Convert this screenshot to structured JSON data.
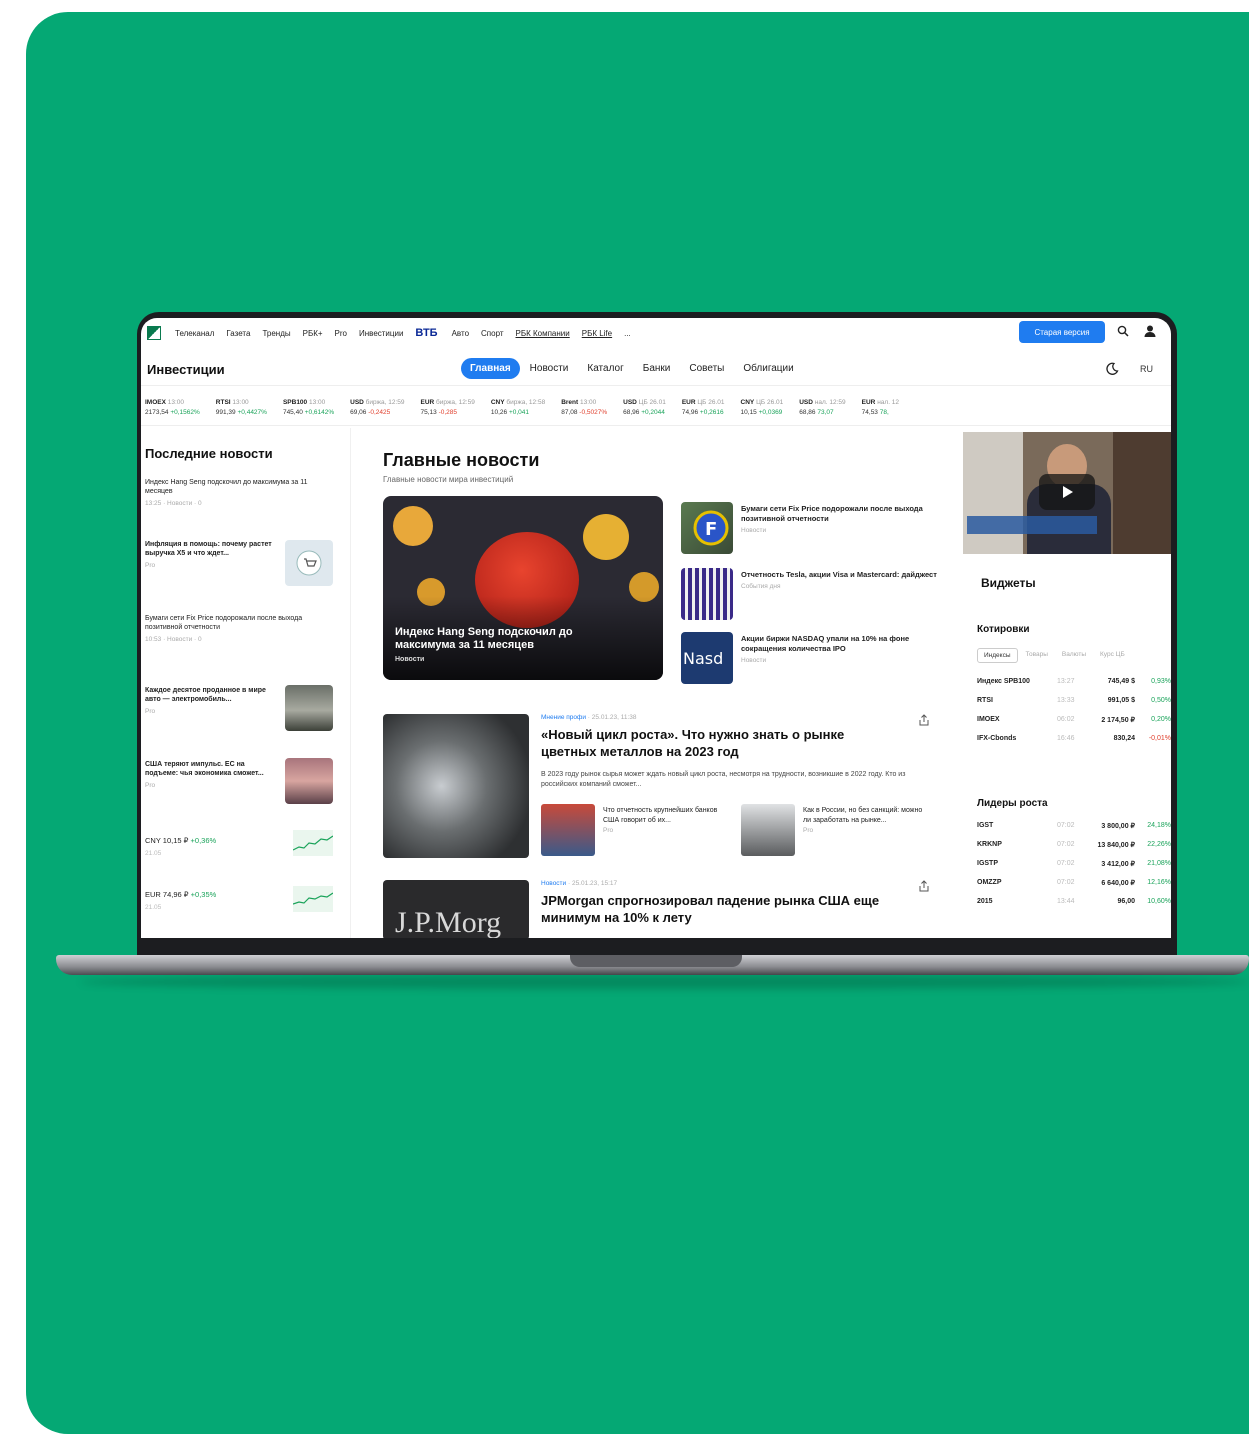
{
  "topnav": {
    "links": [
      "Телеканал",
      "Газета",
      "Тренды",
      "РБК+",
      "Pro",
      "Инвестиции"
    ],
    "partner": "ВТБ",
    "links2": [
      "Авто",
      "Спорт",
      "РБК Компании",
      "РБК Life",
      "..."
    ],
    "old_version": "Старая версия"
  },
  "section": {
    "title": "Инвестиции",
    "tabs": [
      "Главная",
      "Новости",
      "Каталог",
      "Банки",
      "Советы",
      "Облигации"
    ],
    "lang": "RU"
  },
  "ticker": [
    {
      "name": "IMOEX",
      "time": "13:00",
      "value": "2173,54",
      "change": "+0,1562%",
      "dir": "up"
    },
    {
      "name": "RTSI",
      "time": "13:00",
      "value": "991,39",
      "change": "+0,4427%",
      "dir": "up"
    },
    {
      "name": "SPB100",
      "time": "13:00",
      "value": "745,40",
      "change": "+0,6142%",
      "dir": "up"
    },
    {
      "name": "USD",
      "time": "биржа, 12:59",
      "value": "69,06",
      "change": "-0,2425",
      "dir": "dn"
    },
    {
      "name": "EUR",
      "time": "биржа, 12:59",
      "value": "75,13",
      "change": "-0,285",
      "dir": "dn"
    },
    {
      "name": "CNY",
      "time": "биржа, 12:58",
      "value": "10,26",
      "change": "+0,041",
      "dir": "up"
    },
    {
      "name": "Brent",
      "time": "13:00",
      "value": "87,08",
      "change": "-0,5027%",
      "dir": "dn"
    },
    {
      "name": "USD",
      "time": "ЦБ 26.01",
      "value": "68,96",
      "change": "+0,2044",
      "dir": "up"
    },
    {
      "name": "EUR",
      "time": "ЦБ 26.01",
      "value": "74,96",
      "change": "+0,2616",
      "dir": "up"
    },
    {
      "name": "CNY",
      "time": "ЦБ 26.01",
      "value": "10,15",
      "change": "+0,0369",
      "dir": "up"
    },
    {
      "name": "USD",
      "time": "нал. 12:59",
      "value": "68,86",
      "change": "73,07",
      "dir": "up"
    },
    {
      "name": "EUR",
      "time": "нал. 12",
      "value": "74,53",
      "change": "78,",
      "dir": "up"
    }
  ],
  "left": {
    "title": "Последние новости",
    "news": [
      {
        "text": "Индекс Hang Seng подскочил до максимума за 11 месяцев",
        "meta": "13:25 · Новости · 0"
      },
      {
        "text": "Инфляция в помощь: почему растет выручка X5 и что ждет...",
        "meta": "Pro"
      },
      {
        "text": "Бумаги сети Fix Price подорожали после выхода позитивной отчетности",
        "meta": "10:53 · Новости · 0"
      },
      {
        "text": "Каждое десятое проданное в мире авто — электромобиль...",
        "meta": "Pro"
      },
      {
        "text": "США теряют импульс. ЕС на подъеме: чья экономика сможет...",
        "meta": "Pro"
      }
    ],
    "rates": [
      {
        "label": "CNY 10,15 ₽",
        "change": "+0,36%",
        "date": "21.05"
      },
      {
        "label": "EUR 74,96 ₽",
        "change": "+0,35%",
        "date": "21.05"
      }
    ]
  },
  "main": {
    "title": "Главные новости",
    "subtitle": "Главные новости мира инвестиций",
    "hero": {
      "title": "Индекс Hang Seng подскочил до максимума за 11 месяцев",
      "tag": "Новости"
    },
    "side": [
      {
        "text": "Бумаги сети Fix Price подорожали после выхода позитивной отчетности",
        "cat": "Новости"
      },
      {
        "text": "Отчетность Tesla, акции Visa и Mastercard: дайджест",
        "cat": "События дня"
      },
      {
        "text": "Акции биржи NASDAQ упали на 10% на фоне сокращения количества IPO",
        "cat": "Новости"
      }
    ],
    "article1": {
      "cat": "Мнение профи",
      "date": "25.01.23, 11:38",
      "title": "«Новый цикл роста». Что нужно знать о рынке цветных металлов на 2023 год",
      "lead": "В 2023 году рынок сырья может ждать новый цикл роста, несмотря на трудности, возникшие в 2022 году. Кто из российских компаний сможет...",
      "sub": [
        {
          "text": "Что отчетность крупнейших банков США говорит об их...",
          "tag": "Pro"
        },
        {
          "text": "Как в России, но без санкций: можно ли заработать на рынке...",
          "tag": "Pro"
        }
      ]
    },
    "article2": {
      "cat": "Новости",
      "date": "25.01.23, 15:17",
      "title": "JPMorgan спрогнозировал падение рынка США еще минимум на 10% к лету",
      "img_text": "J.P.Morg"
    }
  },
  "right": {
    "widgets_title": "Виджеты",
    "quotes_title": "Котировки",
    "quote_tabs": [
      "Индексы",
      "Товары",
      "Валюты",
      "Курс ЦБ"
    ],
    "quotes": [
      {
        "name": "Индекс SPB100",
        "time": "13:27",
        "value": "745,49 $",
        "change": "0,93%"
      },
      {
        "name": "RTSI",
        "time": "13:33",
        "value": "991,05 $",
        "change": "0,50%"
      },
      {
        "name": "IMOEX",
        "time": "06:02",
        "value": "2 174,50 ₽",
        "change": "0,20%"
      },
      {
        "name": "IFX-Cbonds",
        "time": "16:46",
        "value": "830,24",
        "change": "-0,01%"
      }
    ],
    "leaders_title": "Лидеры роста",
    "leaders": [
      {
        "name": "IGST",
        "time": "07:02",
        "value": "3 800,00 ₽",
        "change": "24,18%"
      },
      {
        "name": "KRKNP",
        "time": "07:02",
        "value": "13 840,00 ₽",
        "change": "22,26%"
      },
      {
        "name": "IGSTP",
        "time": "07:02",
        "value": "3 412,00 ₽",
        "change": "21,08%"
      },
      {
        "name": "OMZZP",
        "time": "07:02",
        "value": "6 640,00 ₽",
        "change": "12,16%"
      },
      {
        "name": "2015",
        "time": "13:44",
        "value": "96,00",
        "change": "10,60%"
      }
    ]
  }
}
